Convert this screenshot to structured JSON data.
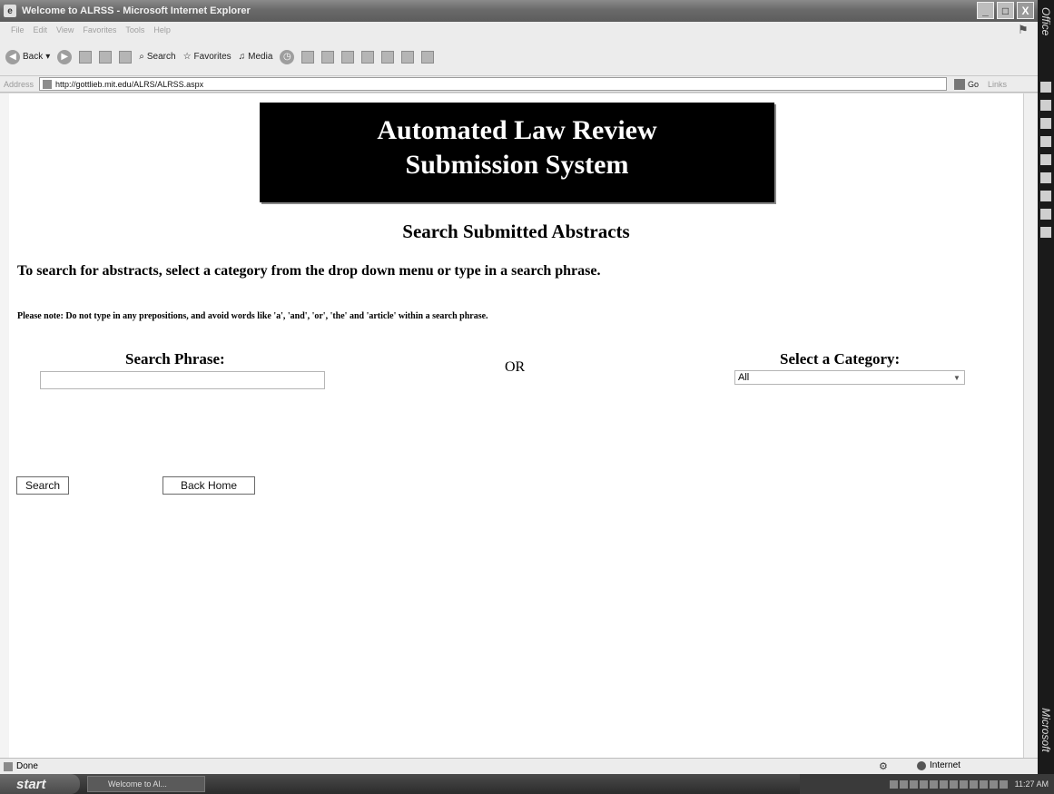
{
  "window": {
    "title": "Welcome to ALRSS - Microsoft Internet Explorer",
    "minimize": "_",
    "restore": "□",
    "close": "X"
  },
  "menubar": {
    "items": [
      "File",
      "Edit",
      "View",
      "Favorites",
      "Tools",
      "Help"
    ]
  },
  "toolbar": {
    "back": "Back",
    "search": "Search",
    "favorites": "Favorites",
    "media": "Media"
  },
  "addressbar": {
    "label": "Address",
    "url": "http://gottlieb.mit.edu/ALRS/ALRSS.aspx",
    "go": "Go",
    "links": "Links"
  },
  "page": {
    "banner_line1": "Automated Law Review",
    "banner_line2": "Submission System",
    "subtitle": "Search Submitted Abstracts",
    "instructions": "To search for abstracts, select a category from the drop down menu or type in a search phrase.",
    "note": "Please note: Do not type in any prepositions, and avoid words like 'a', 'and', 'or', 'the' and 'article' within a search phrase.",
    "search_phrase_label": "Search Phrase:",
    "search_phrase_value": "",
    "or_text": "OR",
    "category_label": "Select a Category:",
    "category_selected": "All",
    "search_button": "Search",
    "back_home_button": "Back Home"
  },
  "statusbar": {
    "status": "Done",
    "zone": "Internet"
  },
  "taskbar": {
    "start": "start",
    "task": "Welcome to Al...",
    "clock": "11:27 AM"
  },
  "sidebar": {
    "top_label": "Office",
    "bottom_label": "Microsoft"
  },
  "colors": {
    "banner_bg": "#000000",
    "banner_text": "#ffffff",
    "page_bg": "#ffffff"
  }
}
